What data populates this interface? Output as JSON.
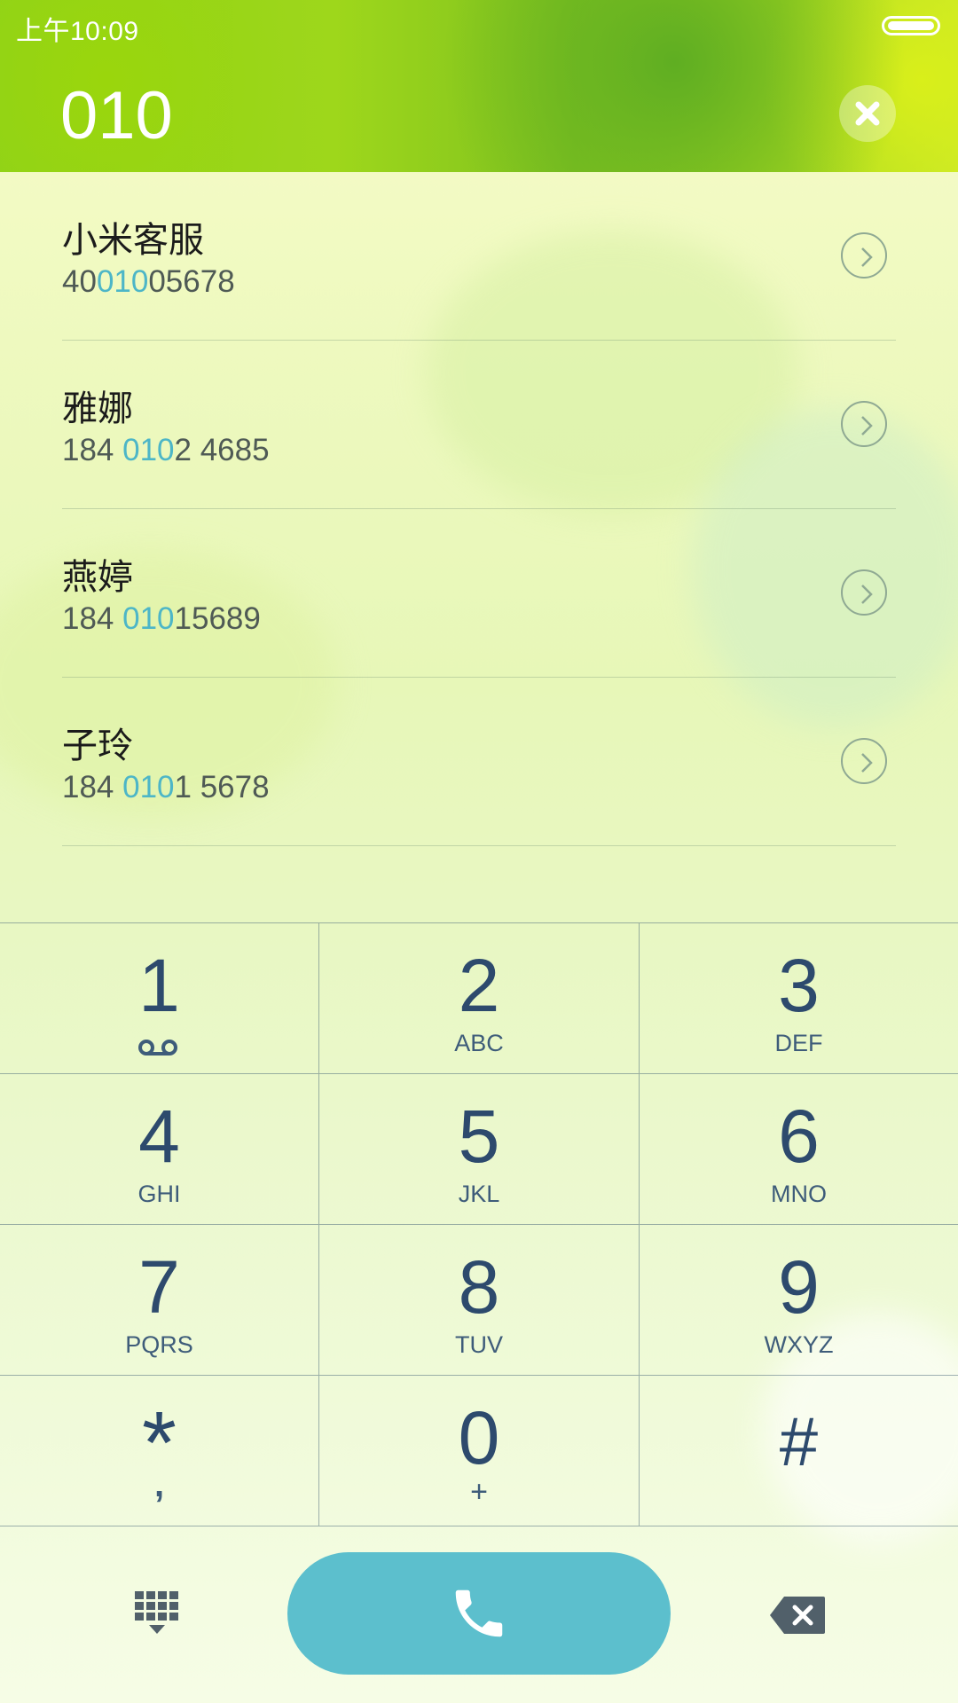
{
  "status_bar": {
    "time": "上午10:09"
  },
  "dialer": {
    "number": "010"
  },
  "contacts": [
    {
      "name": "小米客服",
      "number_before": "40",
      "number_match": "010",
      "number_after": "05678"
    },
    {
      "name": "雅娜",
      "number_before": "184 ",
      "number_match": "010",
      "number_after": "2 4685"
    },
    {
      "name": "燕婷",
      "number_before": "184 ",
      "number_match": "010",
      "number_after": "15689"
    },
    {
      "name": "子玲",
      "number_before": "184 ",
      "number_match": "010",
      "number_after": "1 5678"
    }
  ],
  "keypad": [
    {
      "digit": "1",
      "sub": ""
    },
    {
      "digit": "2",
      "sub": "ABC"
    },
    {
      "digit": "3",
      "sub": "DEF"
    },
    {
      "digit": "4",
      "sub": "GHI"
    },
    {
      "digit": "5",
      "sub": "JKL"
    },
    {
      "digit": "6",
      "sub": "MNO"
    },
    {
      "digit": "7",
      "sub": "PQRS"
    },
    {
      "digit": "8",
      "sub": "TUV"
    },
    {
      "digit": "9",
      "sub": "WXYZ"
    },
    {
      "digit": "*",
      "sub": ","
    },
    {
      "digit": "0",
      "sub": "+"
    },
    {
      "digit": "#",
      "sub": ""
    }
  ],
  "icons": {
    "clear": "close-icon",
    "contact_detail": "chevron-right-icon",
    "voicemail": "voicemail-icon",
    "keypad_toggle": "dialpad-icon",
    "call": "phone-icon",
    "delete": "backspace-icon"
  },
  "colors": {
    "header_green": "#8fd21a",
    "match_highlight": "#4db6c7",
    "call_button": "#5cbfcd",
    "key_text": "#2d4a6d"
  }
}
